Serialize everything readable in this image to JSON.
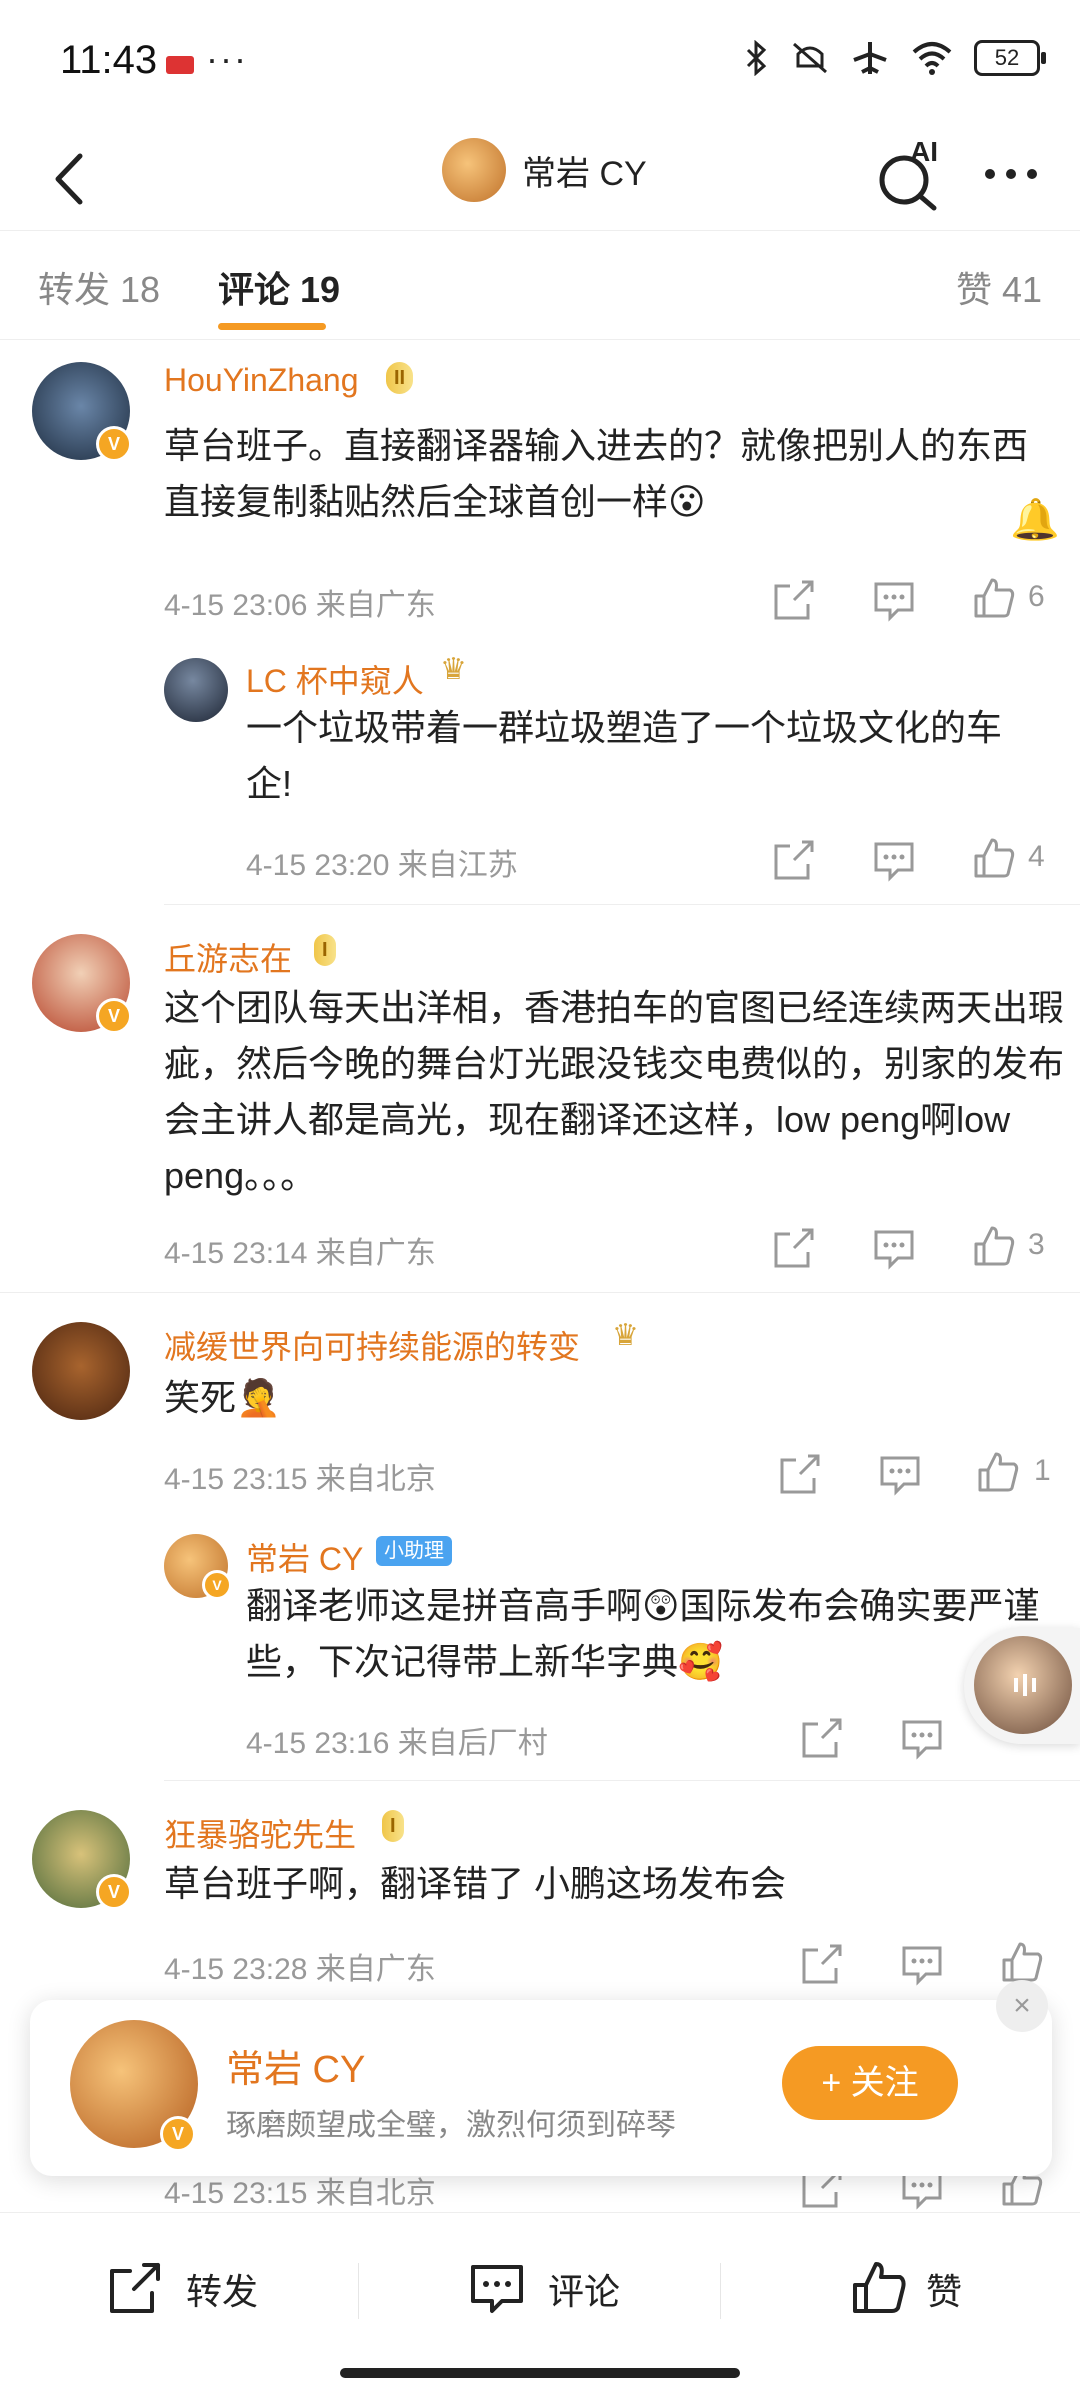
{
  "status_bar": {
    "time": "11:43",
    "dots": "···",
    "battery": "52"
  },
  "header": {
    "author_name": "常岩 CY",
    "ai_label": "AI"
  },
  "tabs": {
    "repost": "转发 18",
    "comment": "评论 19",
    "like": "赞 41"
  },
  "comments": [
    {
      "name": "HouYinZhang",
      "rank": "II",
      "text": "草台班子。直接翻译器输入进去的？就像把别人的东西直接复制黏贴然后全球首创一样",
      "emoji": "😮",
      "meta": "4-15 23:06  来自广东",
      "likes": "6"
    },
    {
      "name": "LC 杯中窥人",
      "text": "一个垃圾带着一群垃圾塑造了一个垃圾文化的车企!",
      "meta": "4-15 23:20  来自江苏",
      "likes": "4"
    },
    {
      "name": "丘游志在",
      "rank": "I",
      "text": "这个团队每天出洋相，香港拍车的官图已经连续两天出瑕疵，然后今晚的舞台灯光跟没钱交电费似的，别家的发布会主讲人都是高光，现在翻译还这样，low peng啊low peng。。。",
      "meta": "4-15 23:14  来自广东",
      "likes": "3"
    },
    {
      "name": "减缓世界向可持续能源的转变",
      "text": "笑死",
      "emoji": "🤦",
      "meta": "4-15 23:15  来自北京",
      "likes": "1"
    },
    {
      "name": "常岩 CY",
      "assist": "小助理",
      "text": "翻译老师这是拼音高手啊",
      "text2": "国际发布会确实要严谨些，下次记得带上新华字典",
      "emoji": "😲",
      "emoji2": "🥰",
      "meta": "4-15 23:16  来自后厂村"
    },
    {
      "name": "狂暴骆驼先生",
      "rank": "I",
      "text": "草台班子啊，翻译错了 小鹏这场发布会",
      "meta": "4-15 23:28  来自广东"
    },
    {
      "meta": "4-15 23:15  来自北京"
    }
  ],
  "popup": {
    "name": "常岩 CY",
    "bio": "琢磨颇望成全璧，激烈何须到碎琴",
    "follow": "+ 关注"
  },
  "bottom_bar": {
    "repost": "转发",
    "comment": "评论",
    "like": "赞"
  },
  "colors": {
    "accent": "#f59a23",
    "username": "#e2761f",
    "meta": "#999999"
  }
}
